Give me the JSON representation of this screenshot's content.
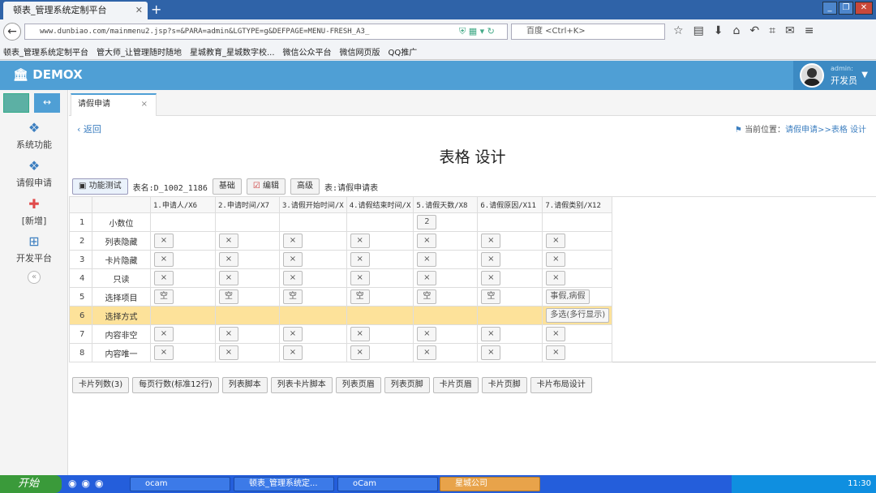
{
  "browser": {
    "tab_title": "顿表_管理系统定制平台",
    "url": "www.dunbiao.com/mainmenu2.jsp?s=&PARA=admin&LGTYPE=g&DEFPAGE=MENU-FRESH_A3_",
    "search_placeholder": "百度 <Ctrl+K>",
    "bookmarks": [
      "顿表_管理系统定制平台",
      "管大师_让管理随时随地",
      "星城教育_星城数字校...",
      "微信公众平台",
      "微信网页版",
      "QQ推广"
    ]
  },
  "app": {
    "logo": "DEMOX",
    "user_name": "admin:",
    "user_role": "开发员"
  },
  "sidebar": {
    "items": [
      {
        "label": "系统功能",
        "icon": "cubes-icon"
      },
      {
        "label": "请假申请",
        "icon": "cubes-icon"
      },
      {
        "label": "[新增]",
        "icon": "plus-square-icon"
      },
      {
        "label": "开发平台",
        "icon": "sitemap-icon"
      }
    ]
  },
  "page": {
    "tab_label": "请假申请",
    "back_label": "返回",
    "crumb_prefix": "当前位置：",
    "crumb_link": "请假申请>>表格 设计",
    "title": "表格 设计"
  },
  "toolbar": {
    "test_btn": "功能测试",
    "table_name": "表名:D_1002_1186",
    "basic_btn": "基础",
    "edit_btn": "编辑",
    "advanced_btn": "高级",
    "table_label": "表:请假申请表"
  },
  "grid": {
    "columns": [
      "1.申请人/X6",
      "2.申请时间/X7",
      "3.请假开始时间/X",
      "4.请假结束时间/X",
      "5.请假天数/X8",
      "6.请假原因/X11",
      "7.请假类别/X12"
    ],
    "rows": [
      {
        "num": "1",
        "name": "小数位",
        "cells": [
          "",
          "",
          "",
          "",
          "2",
          "",
          ""
        ]
      },
      {
        "num": "2",
        "name": "列表隐藏",
        "cells": [
          "×",
          "×",
          "×",
          "×",
          "×",
          "×",
          "×"
        ]
      },
      {
        "num": "3",
        "name": "卡片隐藏",
        "cells": [
          "×",
          "×",
          "×",
          "×",
          "×",
          "×",
          "×"
        ]
      },
      {
        "num": "4",
        "name": "只读",
        "cells": [
          "×",
          "×",
          "×",
          "×",
          "×",
          "×",
          "×"
        ]
      },
      {
        "num": "5",
        "name": "选择项目",
        "cells": [
          "空",
          "空",
          "空",
          "空",
          "空",
          "空",
          "事假,病假"
        ]
      },
      {
        "num": "6",
        "name": "选择方式",
        "cells": [
          "",
          "",
          "",
          "",
          "",
          "",
          "多选(多行显示)"
        ]
      },
      {
        "num": "7",
        "name": "内容非空",
        "cells": [
          "×",
          "×",
          "×",
          "×",
          "×",
          "×",
          "×"
        ]
      },
      {
        "num": "8",
        "name": "内容唯一",
        "cells": [
          "×",
          "×",
          "×",
          "×",
          "×",
          "×",
          "×"
        ]
      }
    ]
  },
  "bottom_buttons": [
    "卡片列数(3)",
    "每页行数(标准12行)",
    "列表脚本",
    "列表卡片脚本",
    "列表页眉",
    "列表页脚",
    "卡片页眉",
    "卡片页脚",
    "卡片布局设计"
  ],
  "taskbar": {
    "start": "开始",
    "items": [
      "ocam",
      "顿表_管理系统定...",
      "oCam",
      "星城公司"
    ],
    "clock": "11:30"
  },
  "colors": {
    "header": "#4f9fd5",
    "highlight_row": "#fde29a",
    "taskbar": "#245edb"
  }
}
